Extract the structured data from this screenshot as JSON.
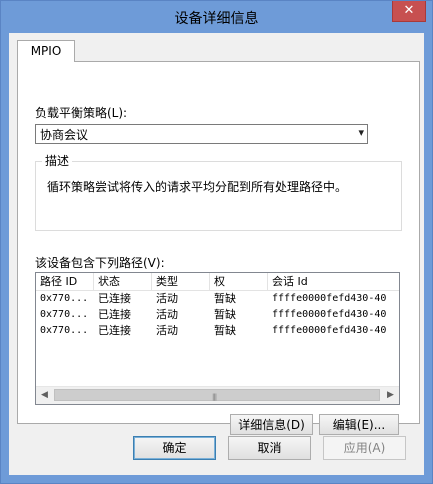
{
  "window": {
    "title": "设备详细信息",
    "close_glyph": "✕"
  },
  "tabs": [
    {
      "label": "MPIO"
    }
  ],
  "policy": {
    "label": "负载平衡策略(L):",
    "selected": "协商会议"
  },
  "description": {
    "title": "描述",
    "text": "循环策略尝试将传入的请求平均分配到所有处理路径中。"
  },
  "paths": {
    "label": "该设备包含下列路径(V):",
    "columns": [
      "路径 ID",
      "状态",
      "类型",
      "权",
      "会话 Id"
    ],
    "rows": [
      [
        "0x770...",
        "已连接",
        "活动",
        "暂缺",
        "ffffe0000fefd430-40"
      ],
      [
        "0x770...",
        "已连接",
        "活动",
        "暂缺",
        "ffffe0000fefd430-40"
      ],
      [
        "0x770...",
        "已连接",
        "活动",
        "暂缺",
        "ffffe0000fefd430-40"
      ]
    ],
    "scroll_left": "◀",
    "scroll_right": "▶",
    "grip": "|||"
  },
  "buttons": {
    "details": "详细信息(D)",
    "edit": "编辑(E)...",
    "ok": "确定",
    "cancel": "取消",
    "apply": "应用(A)"
  }
}
